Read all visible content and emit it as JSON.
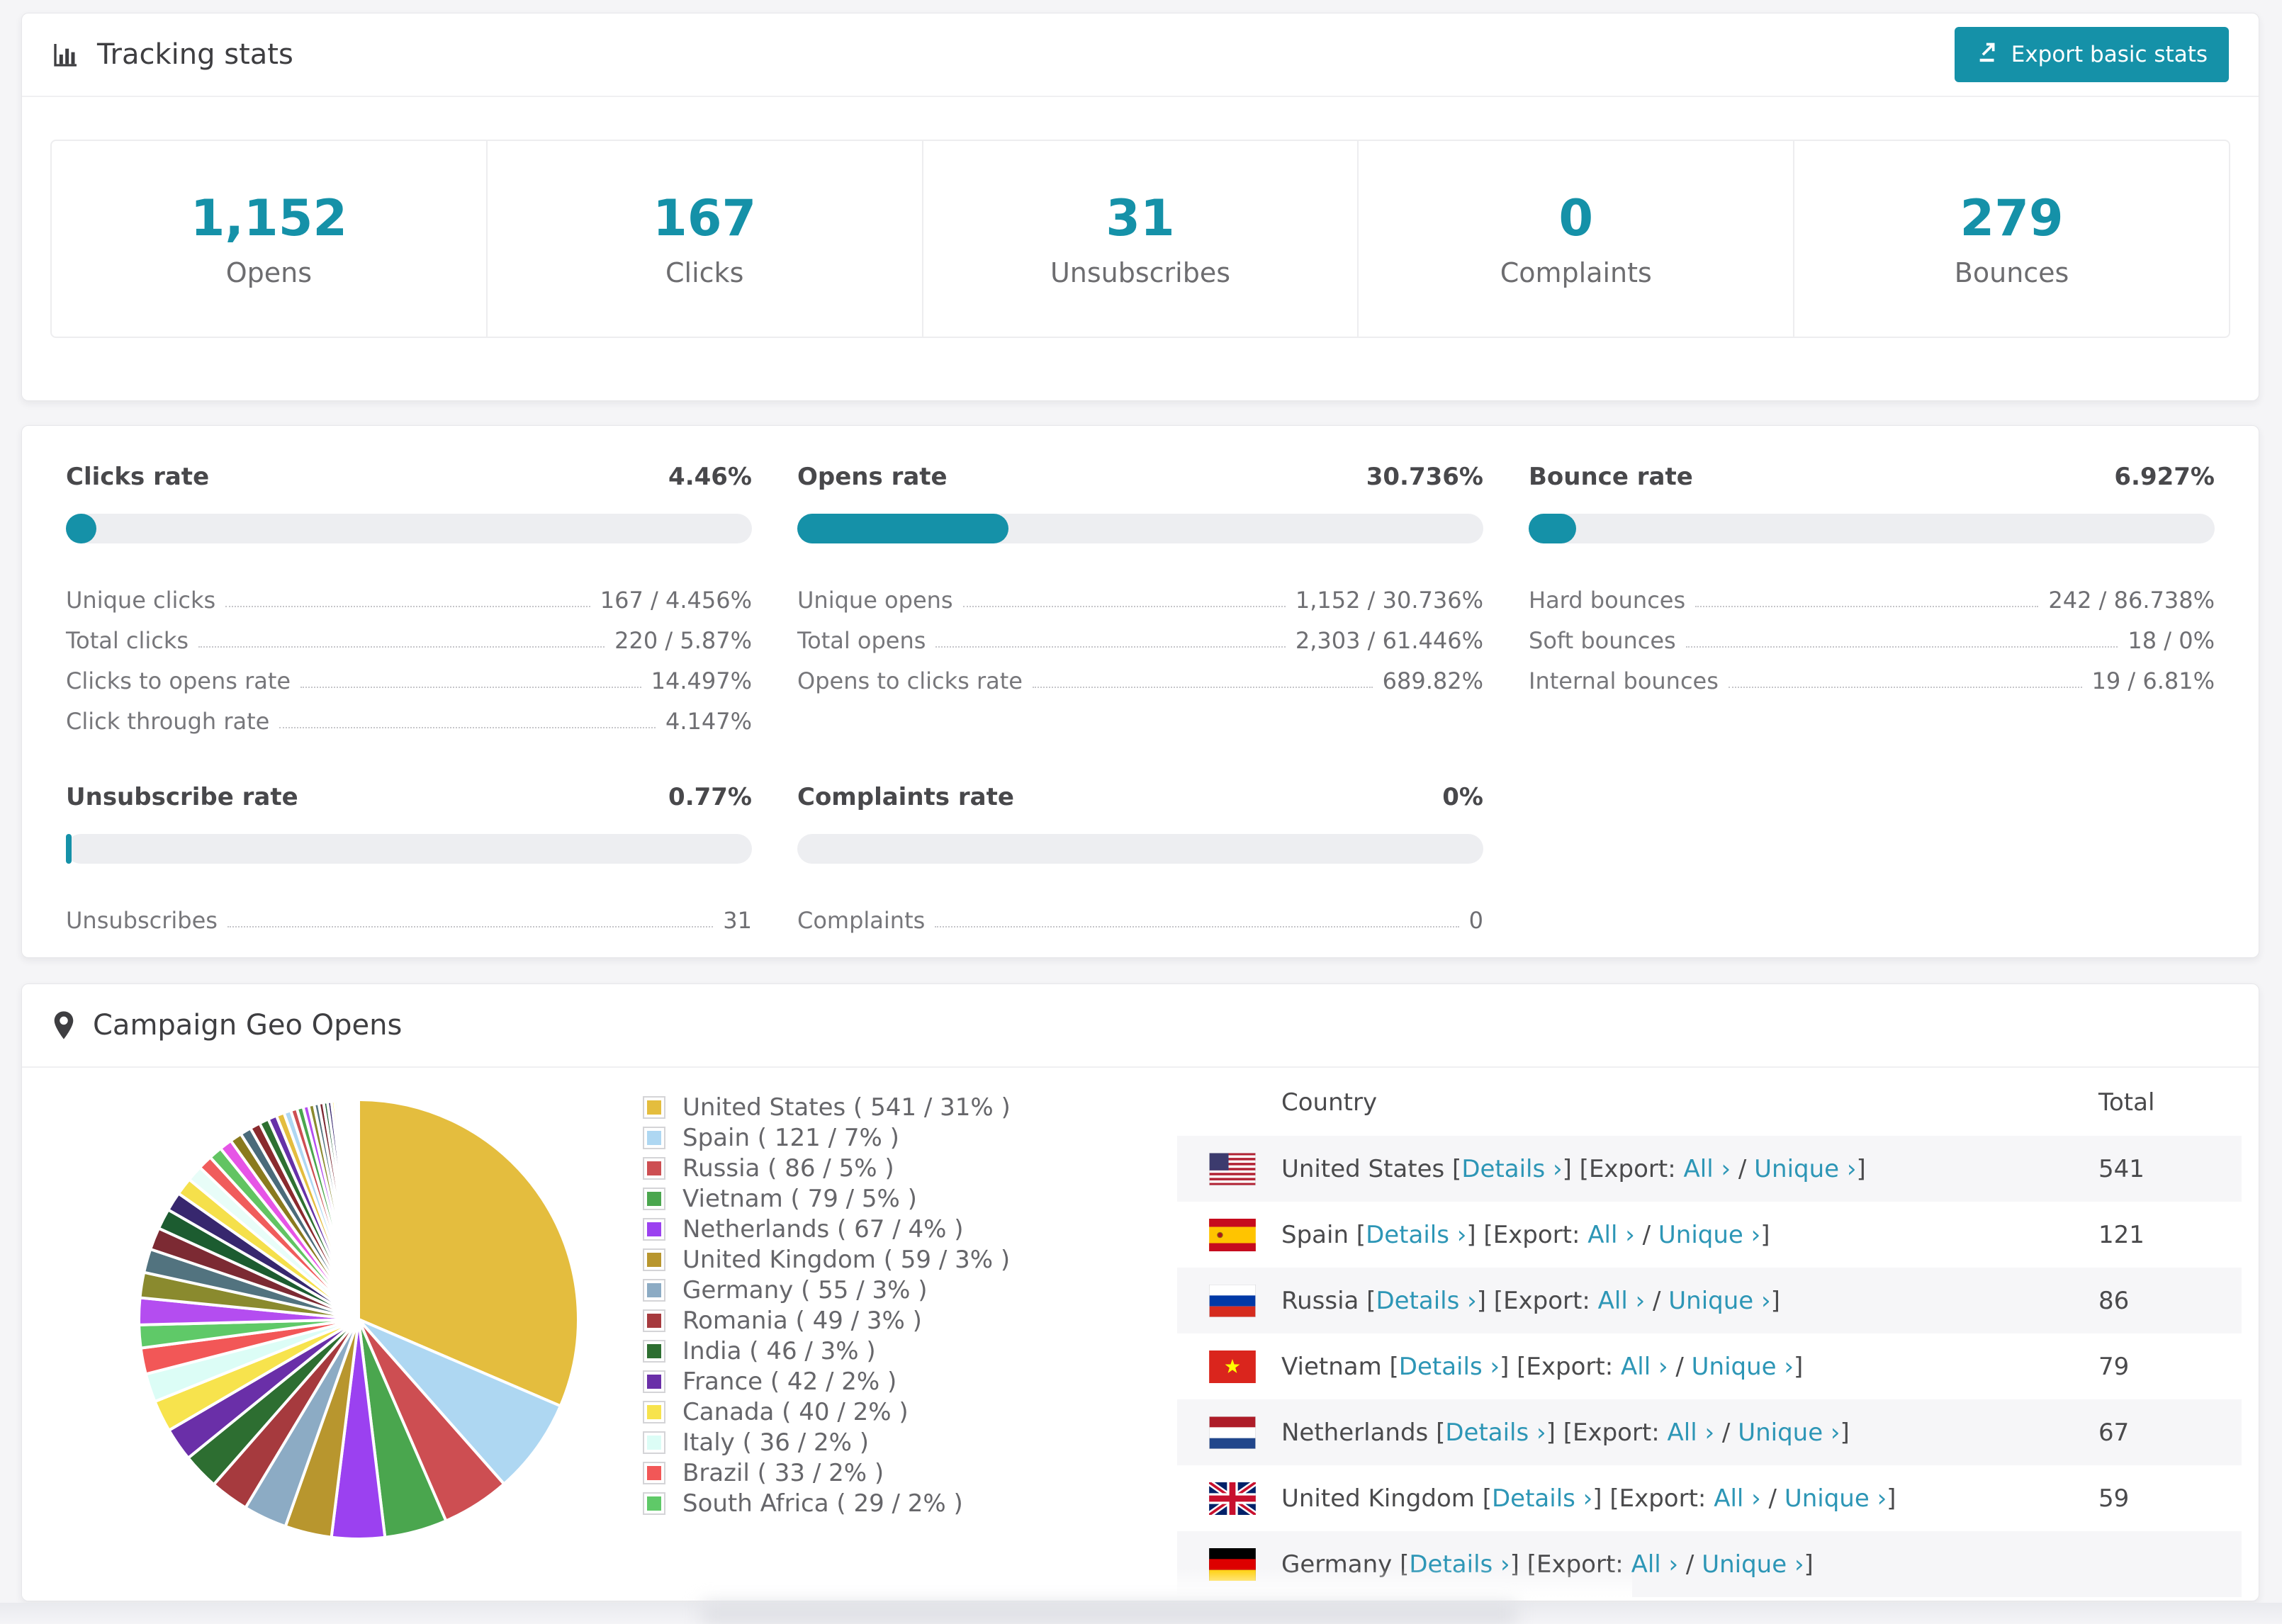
{
  "colors": {
    "accent": "#1591a8",
    "link": "#2d96b6",
    "bar_track": "#edeef1"
  },
  "header": {
    "title": "Tracking stats",
    "export_button": "Export basic stats"
  },
  "summary": {
    "cards": [
      {
        "value": "1,152",
        "label": "Opens"
      },
      {
        "value": "167",
        "label": "Clicks"
      },
      {
        "value": "31",
        "label": "Unsubscribes"
      },
      {
        "value": "0",
        "label": "Complaints"
      },
      {
        "value": "279",
        "label": "Bounces"
      }
    ]
  },
  "rates": [
    {
      "title": "Clicks rate",
      "value": "4.46%",
      "bar_percent": 4.46,
      "rows": [
        [
          "Unique clicks",
          "167 / 4.456%"
        ],
        [
          "Total clicks",
          "220 / 5.87%"
        ],
        [
          "Clicks to opens rate",
          "14.497%"
        ],
        [
          "Click through rate",
          "4.147%"
        ]
      ]
    },
    {
      "title": "Opens rate",
      "value": "30.736%",
      "bar_percent": 30.736,
      "rows": [
        [
          "Unique opens",
          "1,152 / 30.736%"
        ],
        [
          "Total opens",
          "2,303 / 61.446%"
        ],
        [
          "Opens to clicks rate",
          "689.82%"
        ]
      ]
    },
    {
      "title": "Bounce rate",
      "value": "6.927%",
      "bar_percent": 6.927,
      "rows": [
        [
          "Hard bounces",
          "242 / 86.738%"
        ],
        [
          "Soft bounces",
          "18 / 0%"
        ],
        [
          "Internal bounces",
          "19 / 6.81%"
        ]
      ]
    },
    {
      "title": "Unsubscribe rate",
      "value": "0.77%",
      "bar_percent": 0.77,
      "rows": [
        [
          "Unsubscribes",
          "31"
        ]
      ]
    },
    {
      "title": "Complaints rate",
      "value": "0%",
      "bar_percent": 0,
      "rows": [
        [
          "Complaints",
          "0"
        ]
      ]
    }
  ],
  "geo": {
    "title": "Campaign Geo Opens",
    "table": {
      "headers": [
        "Country",
        "Total"
      ],
      "link_details": "Details ›",
      "export_label": "Export:",
      "link_all": "All ›",
      "link_unique": "Unique ›",
      "rows": [
        {
          "country": "United States",
          "flag": "us",
          "total": "541",
          "partial": false
        },
        {
          "country": "Spain",
          "flag": "es",
          "total": "121",
          "partial": false
        },
        {
          "country": "Russia",
          "flag": "ru",
          "total": "86",
          "partial": false
        },
        {
          "country": "Vietnam",
          "flag": "vn",
          "total": "79",
          "partial": false
        },
        {
          "country": "Netherlands",
          "flag": "nl",
          "total": "67",
          "partial": false
        },
        {
          "country": "United Kingdom",
          "flag": "gb",
          "total": "59",
          "partial": false
        },
        {
          "country": "Germany",
          "flag": "de",
          "total": "",
          "partial": true
        }
      ]
    }
  },
  "chart_data": {
    "type": "pie",
    "title": "Campaign Geo Opens",
    "legend_position": "right",
    "slices": [
      {
        "label": "United States",
        "count": 541,
        "percent": 31,
        "color": "#e4bd3e"
      },
      {
        "label": "Spain",
        "count": 121,
        "percent": 7,
        "color": "#aed7f2"
      },
      {
        "label": "Russia",
        "count": 86,
        "percent": 5,
        "color": "#cd4e52"
      },
      {
        "label": "Vietnam",
        "count": 79,
        "percent": 5,
        "color": "#4aa64e"
      },
      {
        "label": "Netherlands",
        "count": 67,
        "percent": 4,
        "color": "#9b41f0"
      },
      {
        "label": "United Kingdom",
        "count": 59,
        "percent": 3,
        "color": "#b8962e"
      },
      {
        "label": "Germany",
        "count": 55,
        "percent": 3,
        "color": "#8cabc4"
      },
      {
        "label": "Romania",
        "count": 49,
        "percent": 3,
        "color": "#a63a3e"
      },
      {
        "label": "India",
        "count": 46,
        "percent": 3,
        "color": "#2d6e31"
      },
      {
        "label": "France",
        "count": 42,
        "percent": 2,
        "color": "#6a2fa8"
      },
      {
        "label": "Canada",
        "count": 40,
        "percent": 2,
        "color": "#f7e34d"
      },
      {
        "label": "Italy",
        "count": 36,
        "percent": 2,
        "color": "#dcfdf6"
      },
      {
        "label": "Brazil",
        "count": 33,
        "percent": 2,
        "color": "#f25757"
      },
      {
        "label": "South Africa",
        "count": 29,
        "percent": 2,
        "color": "#5fc968"
      }
    ],
    "others_tail": {
      "note": "unlabeled long tail of small countries, estimated counts",
      "counts": [
        34,
        32,
        30,
        28,
        26,
        24,
        22,
        20,
        18,
        17,
        16,
        15,
        14,
        13,
        12,
        11,
        10,
        9,
        8,
        8,
        7,
        7,
        6,
        6,
        5,
        5,
        4,
        4,
        3,
        3,
        3,
        2,
        2,
        2,
        2,
        1,
        1,
        1,
        1,
        1,
        1,
        1,
        1,
        1
      ]
    }
  }
}
